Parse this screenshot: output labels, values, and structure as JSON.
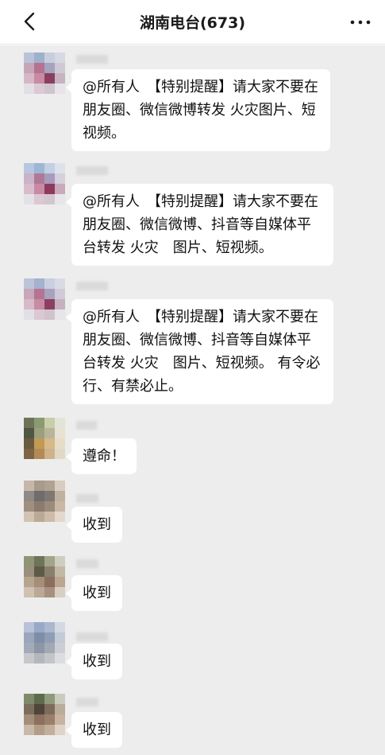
{
  "nav": {
    "title": "湖南电台(673)",
    "back_icon": "chevron-left-icon",
    "more_icon": "ellipsis-icon"
  },
  "messages": [
    {
      "text": "@所有人　【特别提醒】请大家不要在朋友圈、微信微博转发 火灾图片、短视频。"
    },
    {
      "text": "@所有人　【特别提醒】请大家不要在朋友圈、微信微博、抖音等自媒体平台转发 火灾　图片、短视频。"
    },
    {
      "text": "@所有人　【特别提醒】请大家不要在朋友圈、微信微博、抖音等自媒体平台转发 火灾　图片、短视频。 有令必行、有禁必止。"
    },
    {
      "text": "遵命！"
    },
    {
      "text": "收到"
    },
    {
      "text": "收到"
    },
    {
      "text": "收到"
    },
    {
      "text": "收到"
    }
  ],
  "colors": {
    "chat_background": "#ededed",
    "bubble": "#ffffff",
    "text": "#111111"
  }
}
